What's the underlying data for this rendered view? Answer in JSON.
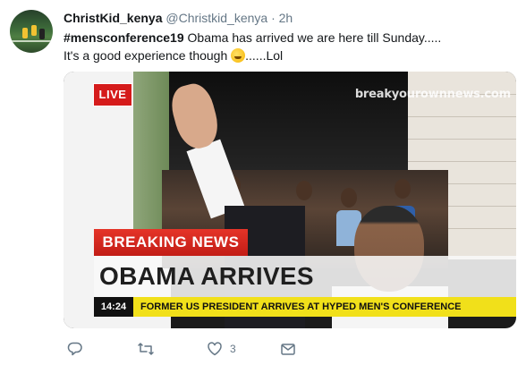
{
  "tweet": {
    "display_name": "ChristKid_kenya",
    "handle": "@Christkid_kenya",
    "separator": "·",
    "time": "2h",
    "hashtag": "#mensconference19",
    "line1_rest": " Obama has arrived we are here till Sunday.....",
    "line2_before_emoji": "It's a good experience though ",
    "line2_after_emoji": "......Lol",
    "emoji": "grinning-sweat-emoji"
  },
  "media": {
    "live_label": "LIVE",
    "watermark": "breakyourownnews.com",
    "breaking_label": "BREAKING NEWS",
    "headline": "OBAMA ARRIVES",
    "ticker_time": "14:24",
    "ticker_text": "FORMER US PRESIDENT ARRIVES AT HYPED MEN'S CONFERENCE",
    "colors": {
      "breaking_red": "#d51b1b",
      "ticker_yellow": "#f1e01a"
    }
  },
  "actions": {
    "reply_icon": "reply-icon",
    "retweet_icon": "retweet-icon",
    "like_icon": "heart-icon",
    "like_count": "3",
    "message_icon": "envelope-icon"
  }
}
